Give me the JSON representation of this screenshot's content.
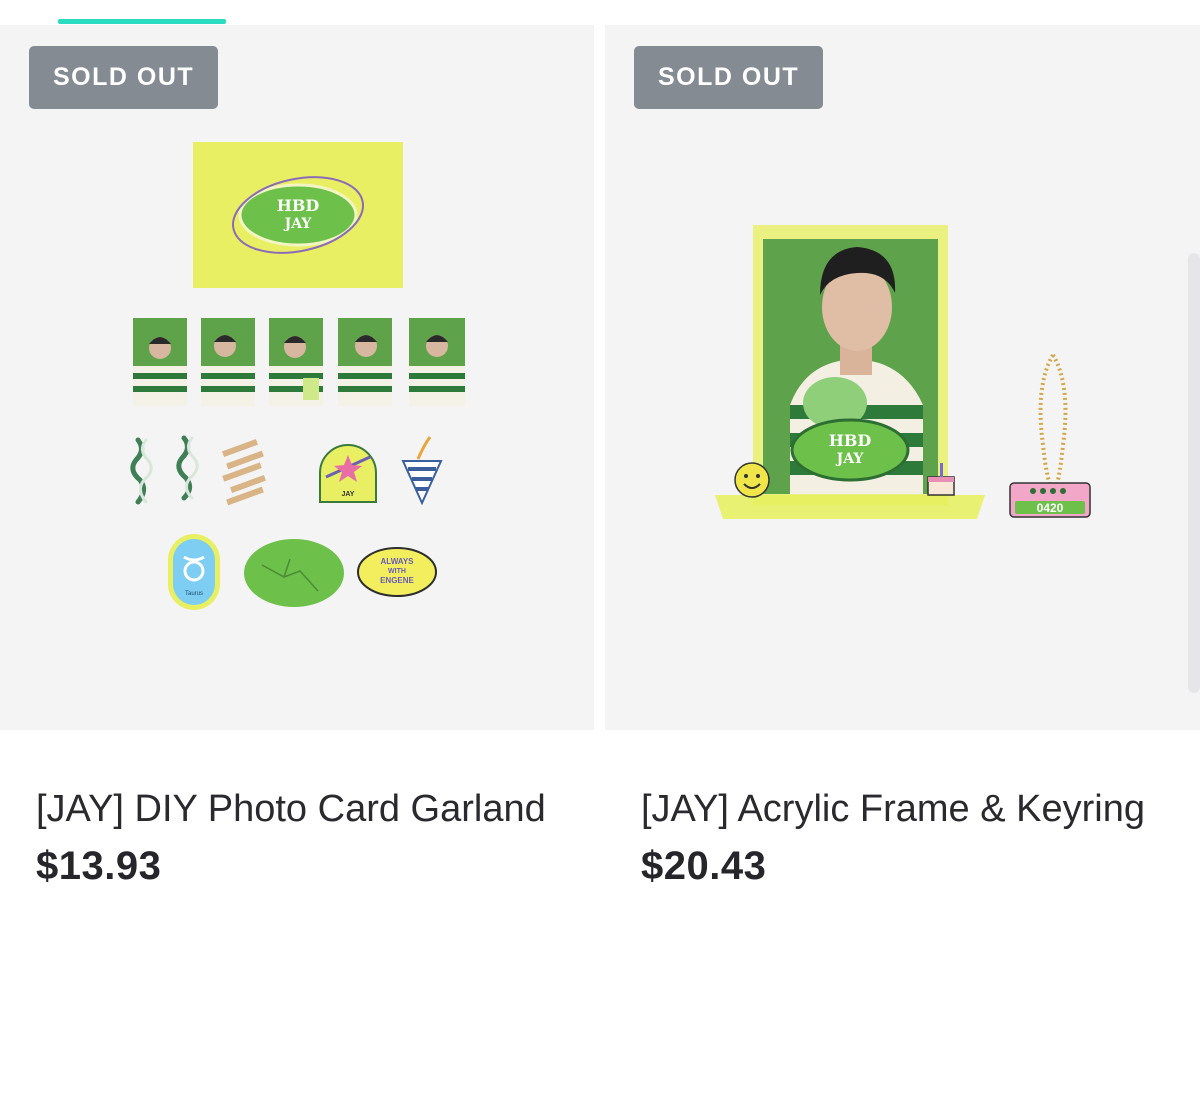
{
  "products": [
    {
      "badge": "SOLD OUT",
      "title": "[JAY] DIY Photo Card Garland",
      "price": "$13.93",
      "art": {
        "card_text_1": "HBD",
        "card_text_2": "JAY",
        "sticker_name": "JAY",
        "sign_label": "Taurus",
        "pin_text_1": "ALWAYS",
        "pin_text_2": "WITH",
        "pin_text_3": "ENGENE"
      }
    },
    {
      "badge": "SOLD OUT",
      "title": "[JAY] Acrylic Frame & Keyring",
      "price": "$20.43",
      "art": {
        "plaque_text_1": "HBD",
        "plaque_text_2": "JAY",
        "keyring_text": "0420"
      }
    }
  ],
  "colors": {
    "accent": "#2bdcc2",
    "badge": "#858b93",
    "image_bg": "#f5f4f5",
    "lime": "#e6f05a",
    "green": "#6dc04a"
  }
}
